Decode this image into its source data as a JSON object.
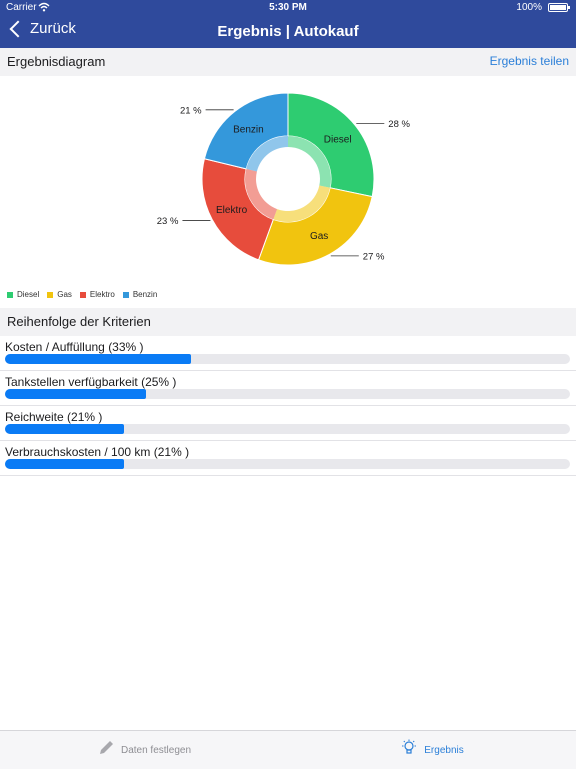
{
  "status_bar": {
    "carrier": "Carrier",
    "time": "5:30 PM",
    "battery": "100%"
  },
  "nav": {
    "back_label": "Zurück",
    "title": "Ergebnis | Autokauf"
  },
  "diagram_section": {
    "title": "Ergebnisdiagram",
    "share_label": "Ergebnis teilen"
  },
  "chart_data": {
    "type": "pie",
    "series": [
      {
        "name": "Diesel",
        "value": 28,
        "label": "28 %",
        "color": "#2ecc71"
      },
      {
        "name": "Gas",
        "value": 27,
        "label": "27 %",
        "color": "#f1c40f"
      },
      {
        "name": "Elektro",
        "value": 23,
        "label": "23 %",
        "color": "#e74c3c"
      },
      {
        "name": "Benzin",
        "value": 21,
        "label": "21 %",
        "color": "#3498db"
      }
    ],
    "legend_placement": "bottom-left"
  },
  "criteria_section": {
    "title": "Reihenfolge der Kriterien",
    "items": [
      {
        "label": "Kosten / Auffüllung (33% )",
        "value": 0.33
      },
      {
        "label": "Tankstellen verfügbarkeit  (25% )",
        "value": 0.25
      },
      {
        "label": "Reichweite (21% )",
        "value": 0.21
      },
      {
        "label": "Verbrauchskosten / 100 km (21% )",
        "value": 0.21
      }
    ]
  },
  "tab_bar": {
    "tabs": [
      {
        "label": "Daten festlegen",
        "icon": "pencil-icon"
      },
      {
        "label": "Ergebnis",
        "icon": "lightbulb-icon"
      }
    ]
  },
  "colors": {
    "nav_background": "#2f4a9c",
    "accent": "#2b7fd8",
    "bar_fill": "#0a7bf5"
  }
}
